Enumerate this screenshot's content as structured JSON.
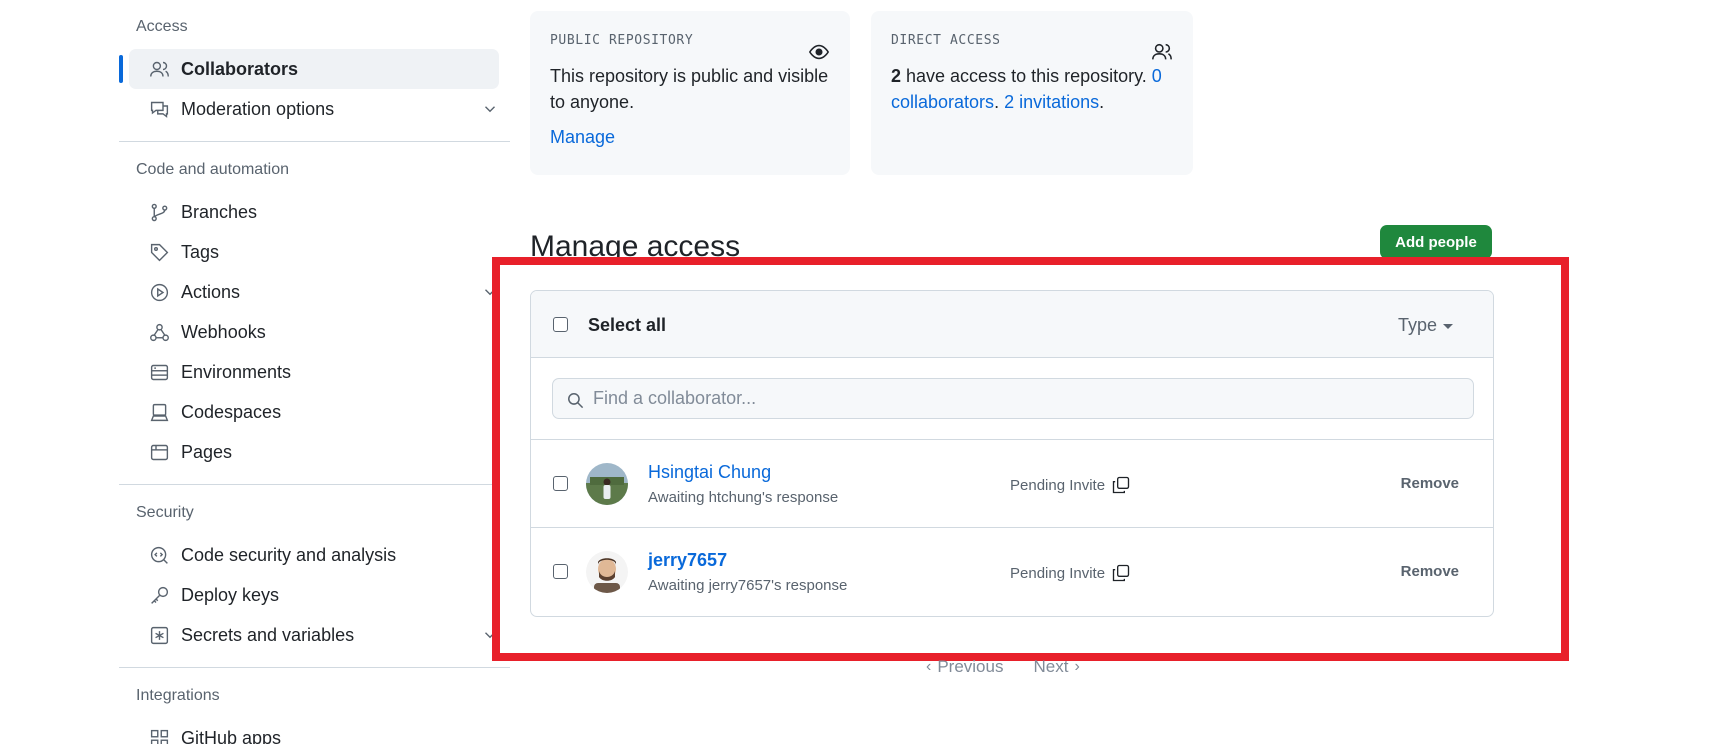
{
  "sidebar": {
    "sections": {
      "access": "Access",
      "code_automation": "Code and automation",
      "security": "Security",
      "integrations": "Integrations"
    },
    "items": {
      "collaborators": "Collaborators",
      "moderation": "Moderation options",
      "branches": "Branches",
      "tags": "Tags",
      "actions": "Actions",
      "webhooks": "Webhooks",
      "environments": "Environments",
      "codespaces": "Codespaces",
      "pages": "Pages",
      "code_security": "Code security and analysis",
      "deploy_keys": "Deploy keys",
      "secrets": "Secrets and variables",
      "github_apps": "GitHub apps"
    }
  },
  "cards": {
    "public": {
      "label": "PUBLIC REPOSITORY",
      "text": "This repository is public and visible to anyone.",
      "link": "Manage"
    },
    "direct": {
      "label": "DIRECT ACCESS",
      "count": "2",
      "text_mid": " have access to this repository. ",
      "collaborators_link": "0 collaborators",
      "sep": ". ",
      "invitations_link": "2 invitations",
      "end": "."
    }
  },
  "manage": {
    "title": "Manage access",
    "add_button": "Add people",
    "select_all": "Select all",
    "type_filter": "Type",
    "search_placeholder": "Find a collaborator..."
  },
  "collaborators": [
    {
      "name": "Hsingtai Chung",
      "status_text": "Awaiting htchung's response",
      "invite": "Pending Invite",
      "action": "Remove"
    },
    {
      "name": "jerry7657",
      "status_text": "Awaiting jerry7657's response",
      "invite": "Pending Invite",
      "action": "Remove"
    }
  ],
  "pagination": {
    "previous": "Previous",
    "next": "Next"
  }
}
